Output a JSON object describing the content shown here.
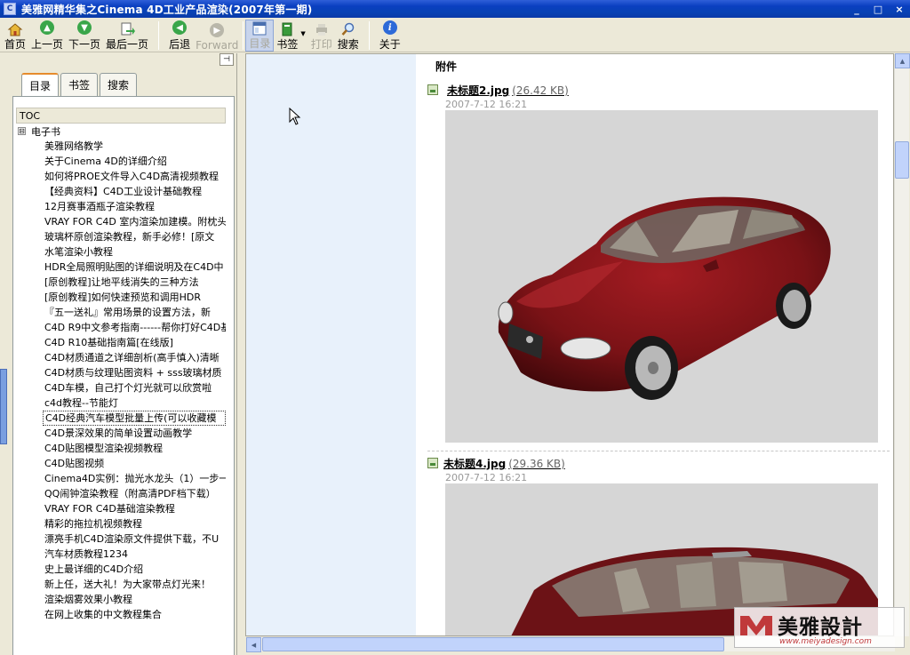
{
  "window": {
    "title": "美雅网精华集之Cinema 4D工业产品渲染(2007年第一期)",
    "controls": [
      "_",
      "□",
      "×"
    ]
  },
  "toolbar": {
    "home": "首页",
    "prev": "上一页",
    "next": "下一页",
    "last": "最后一页",
    "back": "后退",
    "forward": "Forward",
    "contents": "目录",
    "bookmarks": "书签",
    "print": "打印",
    "search": "搜索",
    "about": "关于"
  },
  "sidebar": {
    "pin": "⊣",
    "tabs": [
      {
        "label": "目录",
        "active": true
      },
      {
        "label": "书签",
        "active": false
      },
      {
        "label": "搜索",
        "active": false
      }
    ],
    "tree_header": "TOC",
    "root": {
      "expander": "⊟",
      "label": "电子书"
    },
    "items": [
      "美雅网络教学",
      "关于Cinema 4D的详细介绍",
      "如何将PROE文件导入C4D高清视频教程",
      "【经典资料】C4D工业设计基础教程",
      "12月赛事酒瓶子渲染教程",
      "VRAY FOR C4D 室内渲染加建模。附枕头",
      "玻璃杯原创渲染教程，新手必修！[原文",
      "水笔渲染小教程",
      "HDR全局照明贴图的详细说明及在C4D中",
      "[原创教程]让地平线消失的三种方法",
      "[原创教程]如何快速预览和调用HDR",
      "『五一送礼』常用场景的设置方法，新",
      "C4D R9中文参考指南------帮你打好C4D基",
      "C4D R10基础指南篇[在线版]",
      "C4D材质通道之详细剖析(高手慎入)清晰",
      "C4D材质与纹理贴图资料 + sss玻璃材质",
      "C4D车模，自己打个灯光就可以欣赏啦",
      "c4d教程--节能灯",
      "C4D经典汽车模型批量上传(可以收藏模",
      "C4D景深效果的简单设置动画教学",
      "C4D贴图模型渲染视频教程",
      "C4D贴图视频",
      "Cinema4D实例：抛光水龙头（1）一步一",
      "QQ闹钟渲染教程（附高清PDF档下载）",
      "VRAY FOR C4D基础渲染教程",
      "精彩的拖拉机视频教程",
      "漂亮手机C4D渲染原文件提供下载，不U",
      "汽车材质教程1234",
      "史上最详细的C4D介绍",
      "新上任，送大礼！为大家带点灯光来！",
      "渲染烟雾效果小教程",
      "在网上收集的中文教程集合"
    ],
    "selected_index": 18
  },
  "content": {
    "attachments_title": "附件",
    "files": [
      {
        "name": "未标题2.jpg",
        "size": "(26.42 KB)",
        "date": "2007-7-12 16:21"
      },
      {
        "name": "未标题4.jpg",
        "size": "(29.36 KB)",
        "date": "2007-7-12 16:21"
      }
    ]
  },
  "watermark": {
    "name": "美雅設計",
    "url": "www.meiyadesign.com"
  },
  "colors": {
    "titlebar": "#0a3fc0",
    "car_red": "#7a1216",
    "render_bg": "#d6d6d6",
    "content_side": "#e8f1fb"
  },
  "icons": {
    "home": "house-icon",
    "prev": "up-arrow-icon",
    "next": "down-arrow-icon",
    "last": "page-arrow-icon",
    "back": "back-arrow-icon",
    "forward": "forward-arrow-icon",
    "contents": "window-icon",
    "bookmarks": "book-icon",
    "print": "printer-icon",
    "search": "magnifier-icon",
    "about": "info-icon"
  }
}
